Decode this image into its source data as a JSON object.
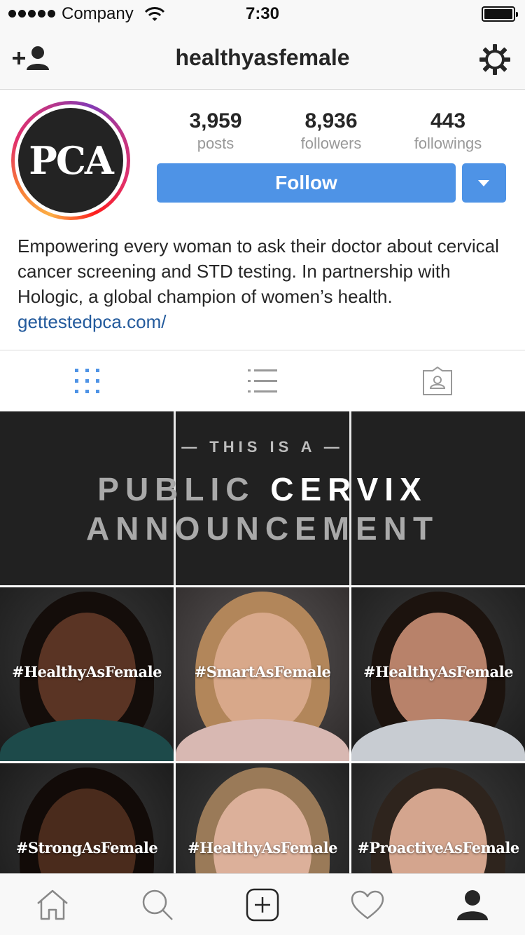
{
  "status_bar": {
    "carrier": "Company",
    "time": "7:30",
    "battery_level": 1.0
  },
  "nav": {
    "title": "healthyasfemale",
    "left_icon": "add-user-icon",
    "right_icon": "gear-icon"
  },
  "profile": {
    "avatar_text": "PCA",
    "stats": [
      {
        "value": "3,959",
        "label": "posts"
      },
      {
        "value": "8,936",
        "label": "followers"
      },
      {
        "value": "443",
        "label": "followings"
      }
    ],
    "follow_label": "Follow",
    "bio": "Empowering every woman to ask their doctor about cervical cancer screening and STD testing. In partnership with Hologic, a global champion of women’s health.",
    "link": "gettestedpca.com/"
  },
  "tabs": [
    {
      "icon": "grid-icon",
      "active": true
    },
    {
      "icon": "list-icon",
      "active": false
    },
    {
      "icon": "tagged-icon",
      "active": false
    }
  ],
  "grid": {
    "banner": {
      "small": "— THIS IS A —",
      "line1_a": "PUBLIC ",
      "line1_b": "CERVIX",
      "line2": "ANNOUNCEMENT"
    },
    "tiles": [
      {
        "tag": "#HealthyAsFemale",
        "skin": "#5a3424",
        "hair": "#140d0a",
        "shirt": "#1d4a4a"
      },
      {
        "tag": "#SmartAsFemale",
        "skin": "#d8a88a",
        "hair": "#b2865a",
        "shirt": "#d8b8b2"
      },
      {
        "tag": "#HealthyAsFemale",
        "skin": "#b8826a",
        "hair": "#1c130e",
        "shirt": "#c8ccd2"
      },
      {
        "tag": "#StrongAsFemale",
        "skin": "#4a2b1c",
        "hair": "#120b08",
        "shirt": "#2a2a2a"
      },
      {
        "tag": "#HealthyAsFemale",
        "skin": "#dcb09a",
        "hair": "#9a7a58",
        "shirt": "#3a3a3a"
      },
      {
        "tag": "#ProactiveAsFemale",
        "skin": "#d4a58e",
        "hair": "#2e241d",
        "shirt": "#3a3a3a"
      }
    ]
  },
  "bottom_bar": [
    {
      "icon": "home-icon"
    },
    {
      "icon": "search-icon"
    },
    {
      "icon": "add-post-icon"
    },
    {
      "icon": "heart-icon"
    },
    {
      "icon": "profile-icon"
    }
  ],
  "colors": {
    "accent": "#4e93e6",
    "link": "#235a9c",
    "tab_active": "#4e93e6",
    "banner_bg": "#212121"
  }
}
